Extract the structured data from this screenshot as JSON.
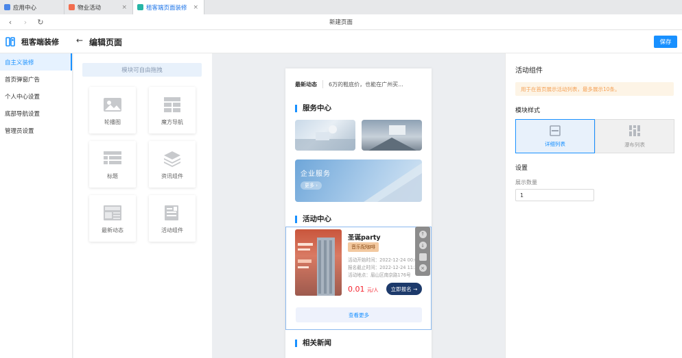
{
  "tabs": [
    {
      "label": "应用中心",
      "icon": "app-icon",
      "color": "#4a86e8",
      "active": false,
      "closable": false
    },
    {
      "label": "物业活动",
      "icon": "activity-icon",
      "color": "#f26d4f",
      "active": false,
      "closable": true
    },
    {
      "label": "租客端页面装修",
      "icon": "decor-icon",
      "color": "#27b5a6",
      "active": true,
      "closable": true
    }
  ],
  "tab_close_glyph": "×",
  "addressbar": {
    "title": "新建页面"
  },
  "header": {
    "brand": "租客端装修",
    "page_title": "编辑页面",
    "save_label": "保存"
  },
  "sidebar": {
    "items": [
      {
        "label": "自主义装修",
        "active": true
      },
      {
        "label": "首页弹窗广告",
        "active": false
      },
      {
        "label": "个人中心设置",
        "active": false
      },
      {
        "label": "底部导航设置",
        "active": false
      },
      {
        "label": "管理员设置",
        "active": false
      }
    ]
  },
  "components": {
    "hint": "模块可自由拖拽",
    "items": [
      {
        "label": "轮播图",
        "icon": "image-icon"
      },
      {
        "label": "魔方导航",
        "icon": "grid-nav-icon"
      },
      {
        "label": "标题",
        "icon": "title-list-icon"
      },
      {
        "label": "资讯组件",
        "icon": "layers-icon"
      },
      {
        "label": "最新动态",
        "icon": "news-icon"
      },
      {
        "label": "活动组件",
        "icon": "activity-doc-icon"
      }
    ]
  },
  "preview": {
    "news_tag": "最新动态",
    "news_text": "6万的鞋底价，也能在广州买...",
    "service_title": "服务中心",
    "service_banner": "企业服务",
    "service_more": "更多 ›",
    "activity_title": "活动中心",
    "activity": {
      "name": "圣诞party",
      "tag": "音乐配咖啡",
      "start": "活动开始时间：2022-12-24 00:00",
      "deadline": "报名截止时间：2022-12-24 11:23",
      "location": "活动地点：眉山区南京路176号",
      "price": "0.01",
      "unit": "元/人",
      "join": "立即报名 →",
      "more": "查看更多"
    },
    "related_title": "相关新闻",
    "tool_glyphs": [
      "↑",
      "↓",
      "",
      "×"
    ]
  },
  "settings": {
    "title": "活动组件",
    "notice": "用于在首页展示活动列表，最多展示10条。",
    "style_label": "模块样式",
    "style_options": [
      {
        "label": "详细列表",
        "icon": "detail-list-icon",
        "selected": true
      },
      {
        "label": "瀑布列表",
        "icon": "waterfall-icon",
        "selected": false
      }
    ],
    "settings_label": "设置",
    "count_label": "展示数量",
    "count_value": "1"
  },
  "colors": {
    "accent": "#1890ff",
    "price": "#f5222d",
    "join_button": "#1d3a6b"
  }
}
